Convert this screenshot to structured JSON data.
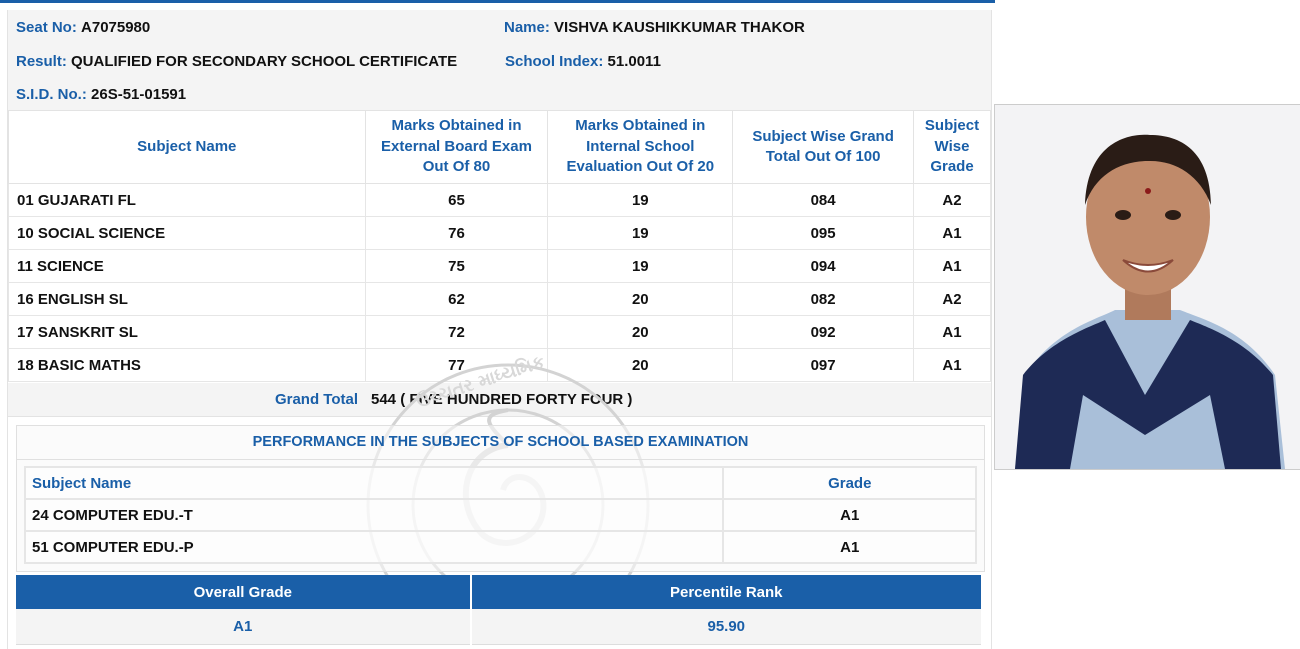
{
  "student": {
    "seat_label": "Seat No:",
    "seat_value": "A7075980",
    "name_label": "Name:",
    "name_value": "VISHVA KAUSHIKKUMAR THAKOR",
    "result_label": "Result:",
    "result_value": "QUALIFIED FOR SECONDARY SCHOOL CERTIFICATE",
    "index_label": "School Index:",
    "index_value": "51.0011",
    "sid_label": "S.I.D. No.:",
    "sid_value": "26S-51-01591"
  },
  "marks_table": {
    "headers": [
      "Subject Name",
      "Marks Obtained in External Board Exam Out Of 80",
      "Marks Obtained in Internal School Evaluation Out Of 20",
      "Subject Wise Grand Total Out Of 100",
      "Subject Wise Grade"
    ],
    "rows": [
      {
        "subject": "01 GUJARATI FL",
        "external": "65",
        "internal": "19",
        "total": "084",
        "grade": "A2"
      },
      {
        "subject": "10 SOCIAL SCIENCE",
        "external": "76",
        "internal": "19",
        "total": "095",
        "grade": "A1"
      },
      {
        "subject": "11 SCIENCE",
        "external": "75",
        "internal": "19",
        "total": "094",
        "grade": "A1"
      },
      {
        "subject": "16 ENGLISH SL",
        "external": "62",
        "internal": "20",
        "total": "082",
        "grade": "A2"
      },
      {
        "subject": "17 SANSKRIT SL",
        "external": "72",
        "internal": "20",
        "total": "092",
        "grade": "A1"
      },
      {
        "subject": "18 BASIC MATHS",
        "external": "77",
        "internal": "20",
        "total": "097",
        "grade": "A1"
      }
    ]
  },
  "grand_total": {
    "label": "Grand Total",
    "value": "544 ( FIVE HUNDRED FORTY FOUR )"
  },
  "school_based": {
    "title": "PERFORMANCE IN THE SUBJECTS OF SCHOOL BASED EXAMINATION",
    "headers": [
      "Subject Name",
      "Grade"
    ],
    "rows": [
      {
        "subject": "24 COMPUTER EDU.-T",
        "grade": "A1"
      },
      {
        "subject": "51 COMPUTER EDU.-P",
        "grade": "A1"
      }
    ]
  },
  "overall": {
    "headers": [
      "Overall Grade",
      "Percentile Rank"
    ],
    "grade": "A1",
    "percentile": "95.90"
  },
  "colors": {
    "accent": "#1a5fa8",
    "row_bg": "#f4f4f4"
  }
}
